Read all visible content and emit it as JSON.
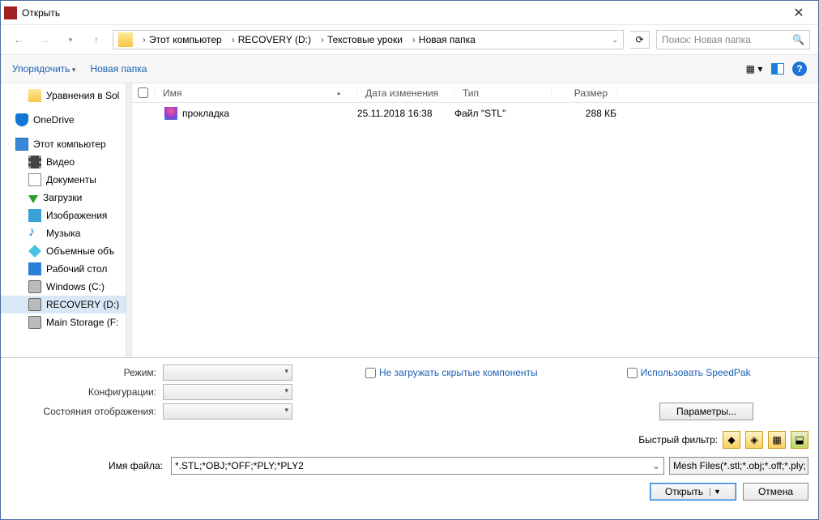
{
  "window": {
    "title": "Открыть"
  },
  "breadcrumb": {
    "root": "Этот компьютер",
    "parts": [
      "RECOVERY (D:)",
      "Текстовые уроки",
      "Новая папка"
    ]
  },
  "search": {
    "placeholder": "Поиск: Новая папка"
  },
  "toolbar": {
    "organize": "Упорядочить",
    "newfolder": "Новая папка"
  },
  "tree": {
    "items": [
      {
        "label": "Уравнения в Sol",
        "icon": "ico-folder",
        "sub": true
      },
      {
        "label": "OneDrive",
        "icon": "ico-onedrive"
      },
      {
        "label": "Этот компьютер",
        "icon": "ico-pc"
      },
      {
        "label": "Видео",
        "icon": "ico-vid",
        "sub": true
      },
      {
        "label": "Документы",
        "icon": "ico-doc",
        "sub": true
      },
      {
        "label": "Загрузки",
        "icon": "ico-dl",
        "sub": true
      },
      {
        "label": "Изображения",
        "icon": "ico-img",
        "sub": true
      },
      {
        "label": "Музыка",
        "icon": "ico-mus",
        "sub": true,
        "glyph": "♪"
      },
      {
        "label": "Объемные объ",
        "icon": "ico-3d",
        "sub": true
      },
      {
        "label": "Рабочий стол",
        "icon": "ico-desk",
        "sub": true
      },
      {
        "label": "Windows (C:)",
        "icon": "ico-disk",
        "sub": true
      },
      {
        "label": "RECOVERY (D:)",
        "icon": "ico-disk",
        "sub": true,
        "sel": true
      },
      {
        "label": "Main Storage (F:",
        "icon": "ico-disk",
        "sub": true
      }
    ]
  },
  "columns": {
    "name": "Имя",
    "date": "Дата изменения",
    "type": "Тип",
    "size": "Размер"
  },
  "files": [
    {
      "name": "прокладка",
      "date": "25.11.2018 16:38",
      "type": "Файл \"STL\"",
      "size": "288 КБ"
    }
  ],
  "options": {
    "mode_label": "Режим:",
    "config_label": "Конфигурации:",
    "display_label": "Состояния отображения:",
    "skip_hidden": "Не загружать скрытые компоненты",
    "speedpak": "Использовать SpeedPak",
    "params": "Параметры..."
  },
  "filter": {
    "label": "Быстрый фильтр:"
  },
  "filename": {
    "label": "Имя файла:",
    "value": "*.STL;*OBJ;*OFF;*PLY;*PLY2",
    "type": "Mesh Files(*.stl;*.obj;*.off;*.ply;"
  },
  "buttons": {
    "open": "Открыть",
    "cancel": "Отмена"
  }
}
